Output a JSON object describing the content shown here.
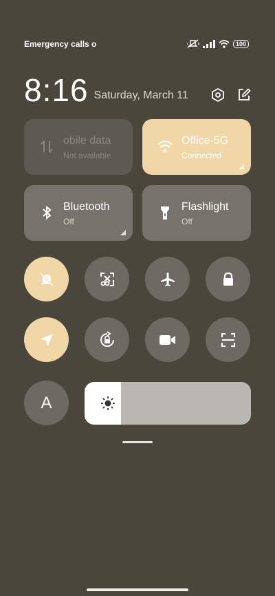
{
  "status_bar": {
    "carrier_text": "Emergency calls o",
    "battery": "100",
    "icons": [
      "mute-vibrate-icon",
      "signal-icon",
      "wifi-icon",
      "battery-icon"
    ]
  },
  "header": {
    "time": "8:16",
    "date": "Saturday, March 11",
    "icons": [
      "settings-icon",
      "edit-icon"
    ]
  },
  "tiles": {
    "mobile_data": {
      "label": "obile data",
      "state": "Not available",
      "icon": "mobile-data-icon"
    },
    "wifi": {
      "label": "Office-5G",
      "state": "Connected",
      "icon": "wifi-icon"
    },
    "bluetooth": {
      "label": "Bluetooth",
      "state": "Off",
      "icon": "bluetooth-icon"
    },
    "flashlight": {
      "label": "Flashlight",
      "state": "Off",
      "icon": "flashlight-icon"
    }
  },
  "toggles_row1": [
    "silent-mode-icon",
    "screenshot-icon",
    "airplane-icon",
    "lock-icon"
  ],
  "toggles_row2": [
    "location-icon",
    "rotation-lock-icon",
    "video-camera-icon",
    "scanner-icon"
  ],
  "auto_brightness": {
    "label": "A"
  },
  "brightness": {
    "level": 0.22,
    "icon": "sun-icon"
  },
  "colors": {
    "background": "#4a463c",
    "accent": "#f1d7a7",
    "tile_off": "#77736c"
  }
}
